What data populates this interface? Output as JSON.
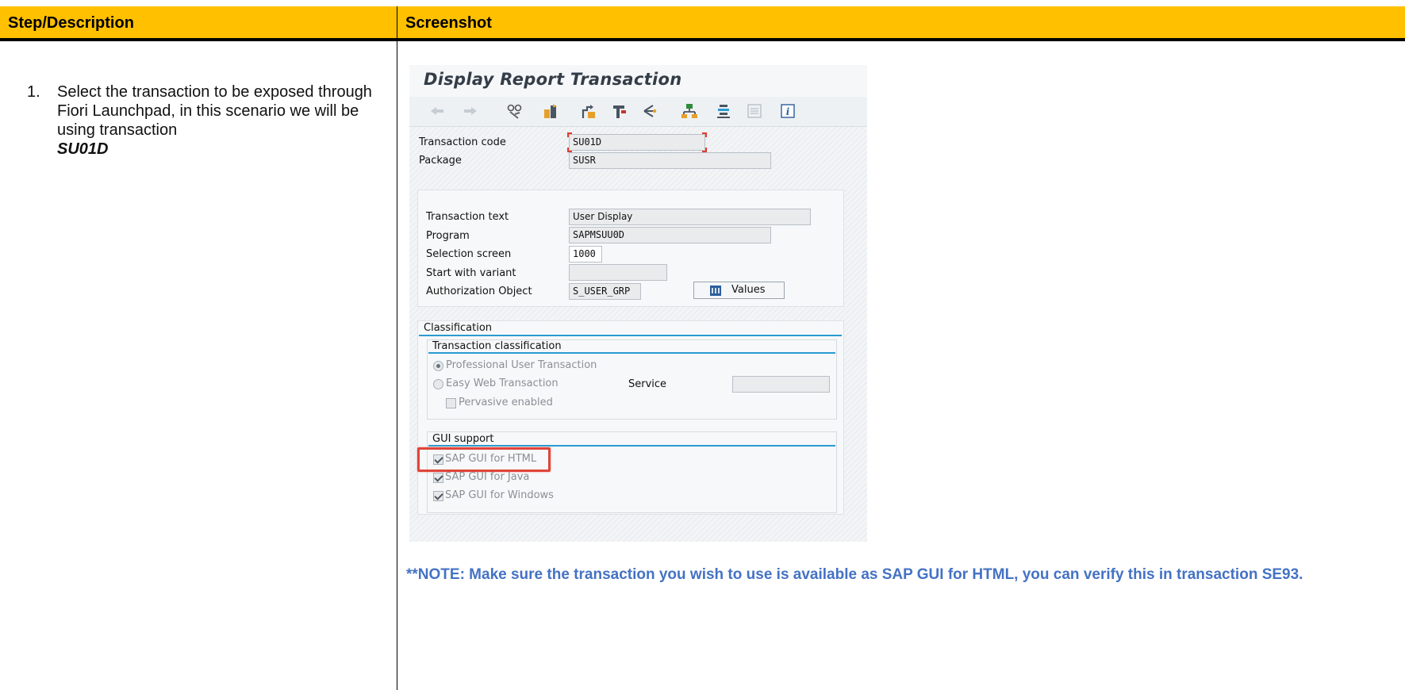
{
  "doc": {
    "header_left": "Step/Description",
    "header_right": "Screenshot",
    "step_number": "1.",
    "step_text": "Select the transaction to be exposed through Fiori Launchpad, in this scenario we will be using transaction",
    "step_code": "SU01D",
    "note": "**NOTE: Make sure the transaction you wish to use is available as SAP GUI for HTML, you can verify this in transaction SE93."
  },
  "sap": {
    "title": "Display Report Transaction",
    "toolbar_icons": [
      "back-arrow-icon",
      "forward-arrow-icon",
      "display-change-icon",
      "other-object-icon",
      "check-icon",
      "activate-icon",
      "where-used-icon",
      "object-list-icon",
      "display-navigation-icon",
      "hierarchy-icon",
      "info-icon"
    ],
    "fields": {
      "tcode_label": "Transaction code",
      "tcode_value": "SU01D",
      "package_label": "Package",
      "package_value": "SUSR",
      "ttext_label": "Transaction text",
      "ttext_value": "User Display",
      "program_label": "Program",
      "program_value": "SAPMSUU0D",
      "selscreen_label": "Selection screen",
      "selscreen_value": "1000",
      "variant_label": "Start with variant",
      "variant_value": "",
      "authobj_label": "Authorization Object",
      "authobj_value": "S_USER_GRP",
      "values_button": "Values"
    },
    "classification": {
      "title": "Classification",
      "sub_title": "Transaction classification",
      "opt_professional": "Professional User Transaction",
      "opt_easyweb": "Easy Web Transaction",
      "service_label": "Service",
      "service_value": "",
      "pervasive": "Pervasive enabled"
    },
    "gui_support": {
      "title": "GUI support",
      "html": "SAP GUI for HTML",
      "java": "SAP GUI for Java",
      "windows": "SAP GUI for Windows"
    }
  }
}
